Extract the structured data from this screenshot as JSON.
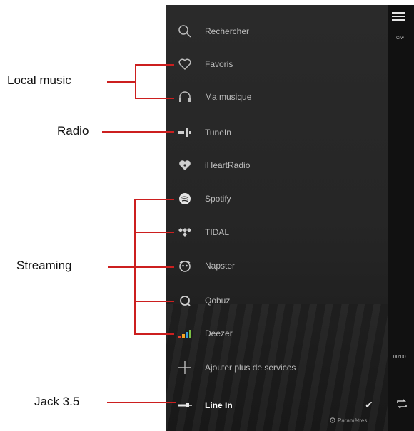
{
  "annotations": {
    "local_music": "Local music",
    "radio": "Radio",
    "streaming": "Streaming",
    "jack": "Jack 3.5"
  },
  "menu": {
    "items": [
      {
        "label": "Rechercher",
        "icon": "search-icon"
      },
      {
        "label": "Favoris",
        "icon": "heart-icon"
      },
      {
        "label": "Ma musique",
        "icon": "headphones-icon"
      },
      {
        "label": "TuneIn",
        "icon": "tunein-icon"
      },
      {
        "label": "iHeartRadio",
        "icon": "iheartradio-icon"
      },
      {
        "label": "Spotify",
        "icon": "spotify-icon"
      },
      {
        "label": "TIDAL",
        "icon": "tidal-icon"
      },
      {
        "label": "Napster",
        "icon": "napster-icon"
      },
      {
        "label": "Qobuz",
        "icon": "qobuz-icon"
      },
      {
        "label": "Deezer",
        "icon": "deezer-icon"
      },
      {
        "label": "Ajouter plus de services",
        "icon": "plus-icon"
      },
      {
        "label": "Line In",
        "icon": "line-in-icon"
      }
    ],
    "settings_label": "Paramètres",
    "selected_check": "✔"
  },
  "player": {
    "top_small_text": "Crw",
    "time": "00:00"
  },
  "colors": {
    "annotation_line": "#cc1f1f",
    "menu_bg": "#262626",
    "menu_text": "#bdbdbd"
  }
}
